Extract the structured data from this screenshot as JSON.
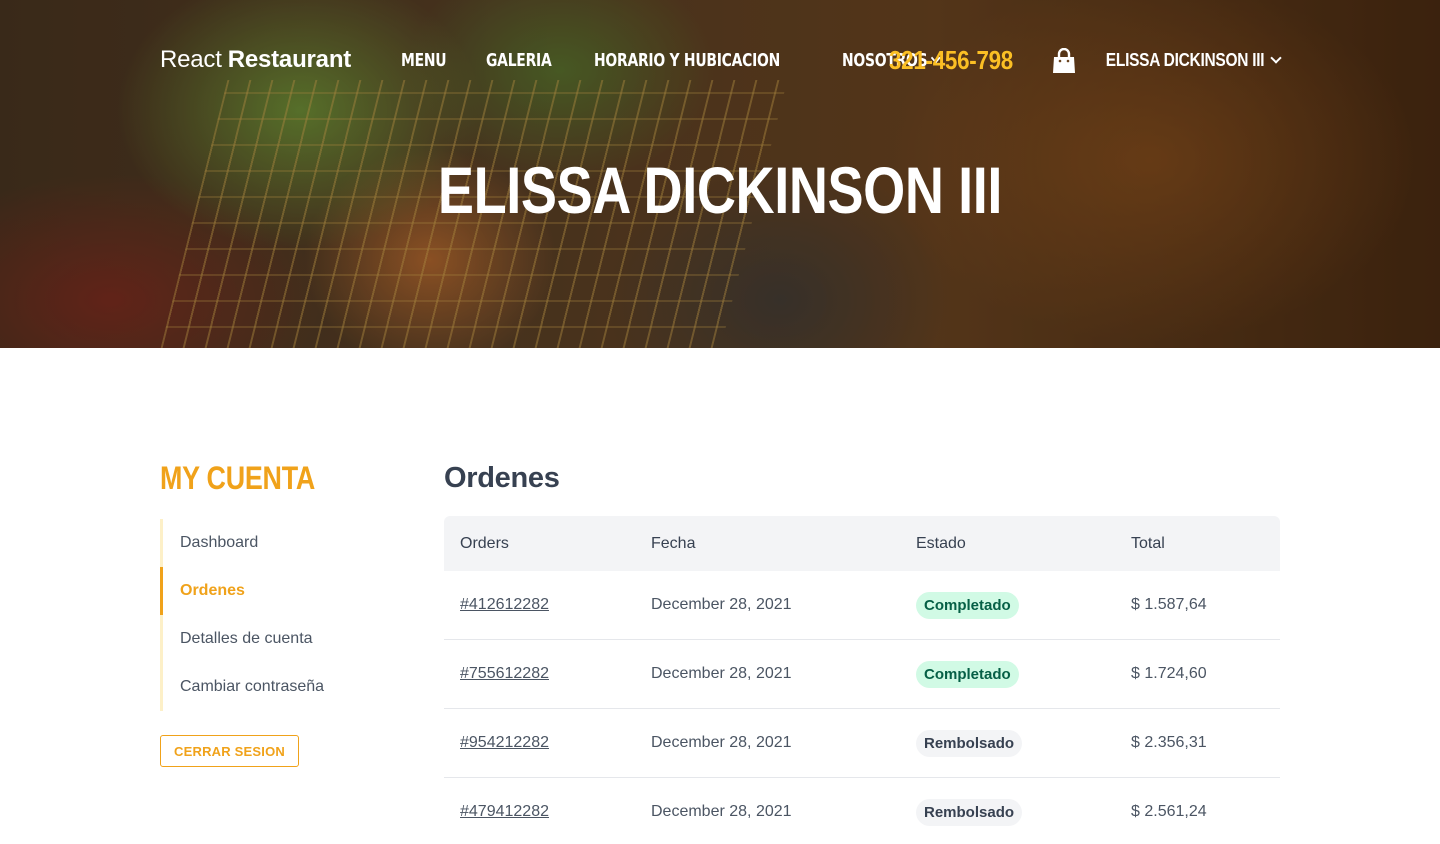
{
  "header": {
    "brand_light": "React",
    "brand_bold": "Restaurant",
    "nav": [
      "MENU",
      "GALERIA",
      "HORARIO Y HUBICACION",
      "NOSOTROS"
    ],
    "phone": "321-456-798",
    "user_name": "ELISSA DICKINSON III"
  },
  "hero": {
    "title": "ELISSA DICKINSON III"
  },
  "sidebar": {
    "heading": "MY CUENTA",
    "items": [
      "Dashboard",
      "Ordenes",
      "Detalles de cuenta",
      "Cambiar contraseña"
    ],
    "active_item": "Ordenes",
    "logout_label": "CERRAR SESION"
  },
  "orders": {
    "title": "Ordenes",
    "columns": [
      "Orders",
      "Fecha",
      "Estado",
      "Total"
    ],
    "rows": [
      {
        "id": "#412612282",
        "date": "December 28, 2021",
        "status": "Completado",
        "total": "$ 1.587,64"
      },
      {
        "id": "#755612282",
        "date": "December 28, 2021",
        "status": "Completado",
        "total": "$ 1.724,60"
      },
      {
        "id": "#954212282",
        "date": "December 28, 2021",
        "status": "Rembolsado",
        "total": "$ 2.356,31"
      },
      {
        "id": "#479412282",
        "date": "December 28, 2021",
        "status": "Rembolsado",
        "total": "$ 2.561,24"
      }
    ]
  },
  "colors": {
    "accent": "#f0a21a",
    "phone": "#fbbf24",
    "status_completed_bg": "#d1fae5",
    "status_completed_text": "#065f46",
    "status_refunded_bg": "#f3f4f6"
  },
  "icons": {
    "cart": "shopping-bag-icon",
    "dropdown": "chevron-down-icon"
  }
}
